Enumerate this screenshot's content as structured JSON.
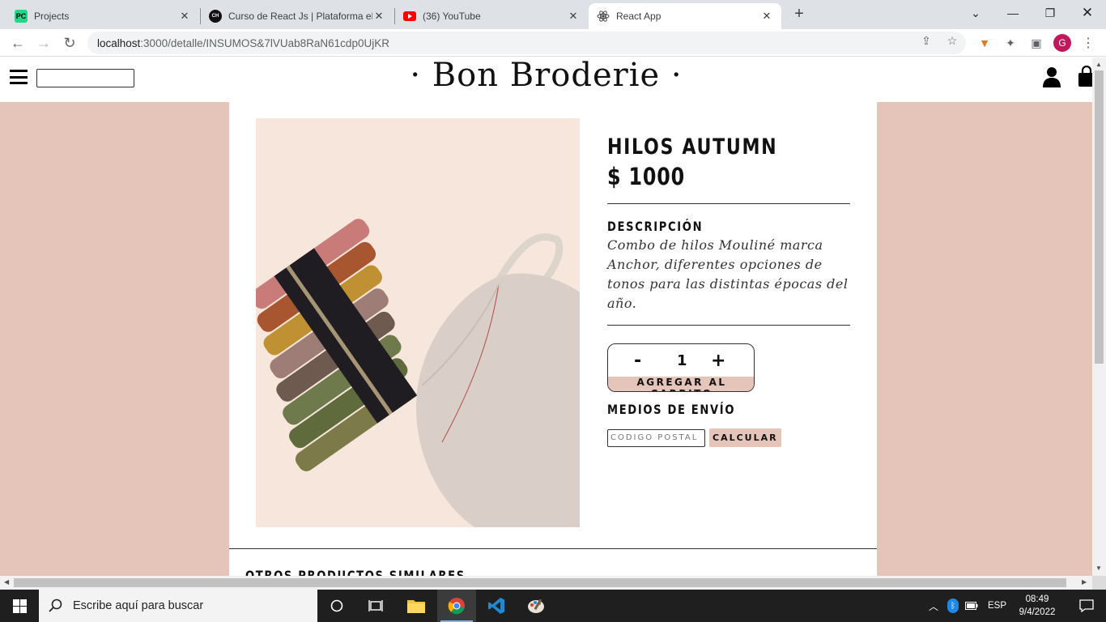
{
  "browser": {
    "tabs": [
      {
        "title": "Projects",
        "favicon": "pycharm-icon",
        "active": false
      },
      {
        "title": "Curso de React Js | Plataforma eL",
        "favicon": "coderhouse-icon",
        "active": false
      },
      {
        "title": "(36) YouTube",
        "favicon": "youtube-icon",
        "active": false
      },
      {
        "title": "React App",
        "favicon": "react-icon",
        "active": true
      }
    ],
    "url_host": "localhost",
    "url_rest": ":3000/detalle/INSUMOS&7lVUab8RaN61cdp0UjKR",
    "profile_initial": "G"
  },
  "site": {
    "brand": "· Bon Broderie ·",
    "search_value": "",
    "accent_color": "#e5c4b9"
  },
  "product": {
    "title": "HILOS AUTUMN",
    "price": "$ 1000",
    "description_heading": "DESCRIPCIÓN",
    "description": "Combo de hilos Mouliné marca Anchor, diferentes opciones de tonos para las distintas épocas del año.",
    "quantity": "1",
    "minus_label": "-",
    "plus_label": "+",
    "add_to_cart_label": "AGREGAR AL CARRITO",
    "shipping_heading": "MEDIOS DE ENVÍO",
    "zip_placeholder": "CÓDIGO POSTAL",
    "calculate_label": "CALCULAR",
    "similar_heading": "OTROS PRODUCTOS SIMILARES"
  },
  "taskbar": {
    "search_placeholder": "Escribe aquí para buscar",
    "language": "ESP",
    "time": "08:49",
    "date": "9/4/2022"
  }
}
